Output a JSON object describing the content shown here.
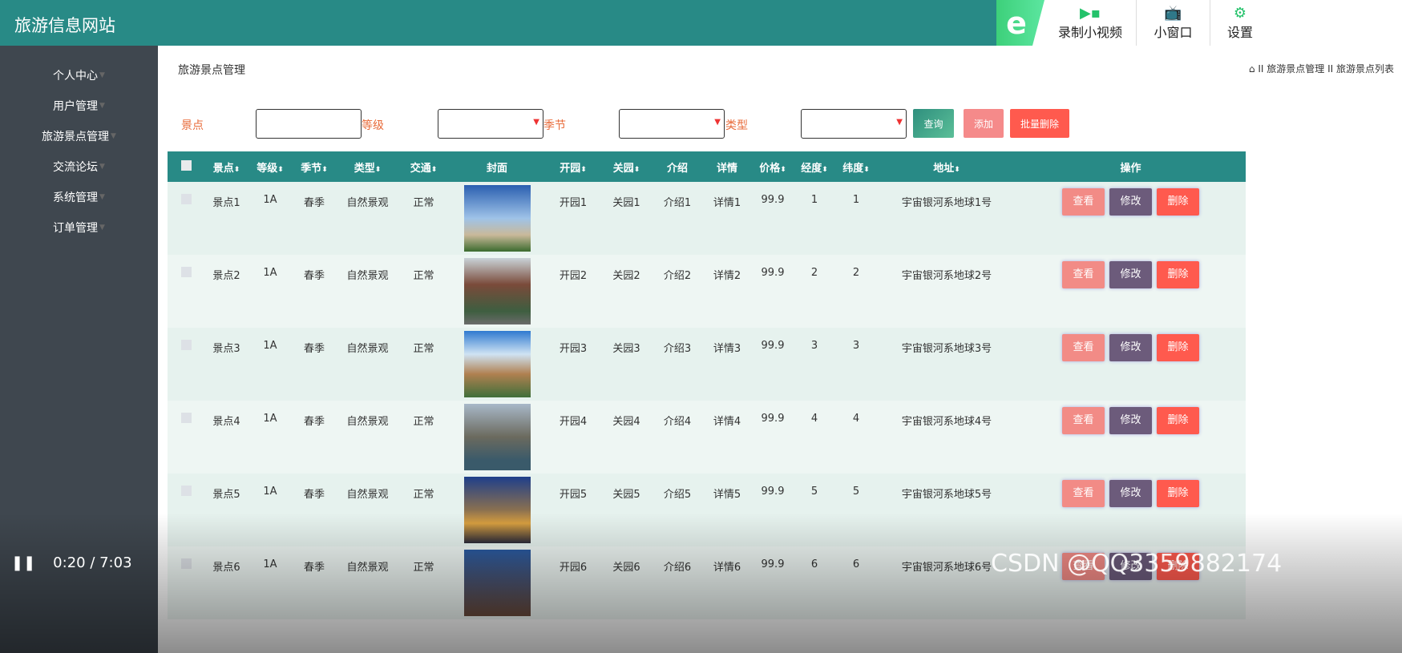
{
  "header": {
    "title": "旅游信息网站",
    "tools": [
      {
        "icon": "video-record-icon",
        "label": "录制小视频"
      },
      {
        "icon": "tv-icon",
        "label": "小窗口"
      },
      {
        "icon": "gear-icon",
        "label": "设置"
      }
    ],
    "logo": "e"
  },
  "sidebar": {
    "items": [
      {
        "label": "个人中心"
      },
      {
        "label": "用户管理"
      },
      {
        "label": "旅游景点管理"
      },
      {
        "label": "交流论坛"
      },
      {
        "label": "系统管理"
      },
      {
        "label": "订单管理"
      }
    ]
  },
  "page": {
    "title": "旅游景点管理",
    "breadcrumb": [
      "旅游景点管理",
      "旅游景点列表"
    ],
    "sep": "II"
  },
  "filters": {
    "labels": [
      "景点",
      "等级",
      "季节",
      "类型"
    ],
    "query": "查询",
    "add": "添加",
    "batch_delete": "批量删除"
  },
  "table": {
    "columns": [
      "景点",
      "等级",
      "季节",
      "类型",
      "交通",
      "封面",
      "开园",
      "关园",
      "介绍",
      "详情",
      "价格",
      "经度",
      "纬度",
      "地址",
      "操作"
    ],
    "rows": [
      [
        "景点1",
        "1A",
        "春季",
        "自然景观",
        "正常",
        "开园1",
        "关园1",
        "介绍1",
        "详情1",
        "99.9",
        "1",
        "1",
        "宇宙银河系地球1号"
      ],
      [
        "景点2",
        "1A",
        "春季",
        "自然景观",
        "正常",
        "开园2",
        "关园2",
        "介绍2",
        "详情2",
        "99.9",
        "2",
        "2",
        "宇宙银河系地球2号"
      ],
      [
        "景点3",
        "1A",
        "春季",
        "自然景观",
        "正常",
        "开园3",
        "关园3",
        "介绍3",
        "详情3",
        "99.9",
        "3",
        "3",
        "宇宙银河系地球3号"
      ],
      [
        "景点4",
        "1A",
        "春季",
        "自然景观",
        "正常",
        "开园4",
        "关园4",
        "介绍4",
        "详情4",
        "99.9",
        "4",
        "4",
        "宇宙银河系地球4号"
      ],
      [
        "景点5",
        "1A",
        "春季",
        "自然景观",
        "正常",
        "开园5",
        "关园5",
        "介绍5",
        "详情5",
        "99.9",
        "5",
        "5",
        "宇宙银河系地球5号"
      ],
      [
        "景点6",
        "1A",
        "春季",
        "自然景观",
        "正常",
        "开园6",
        "关园6",
        "介绍6",
        "详情6",
        "99.9",
        "6",
        "6",
        "宇宙银河系地球6号"
      ]
    ],
    "actions": [
      "查看",
      "修改",
      "删除"
    ]
  },
  "colors": {
    "teal": "#288a86",
    "view": "#f28b86",
    "edit": "#6c5b7b",
    "delete": "#ff5a4e",
    "add": "#f58a8a",
    "batch": "#ff5a4e",
    "query": "#3a9f86"
  },
  "video": {
    "time": "0:20 / 7:03"
  },
  "watermark": "CSDN @QQ3359882174"
}
